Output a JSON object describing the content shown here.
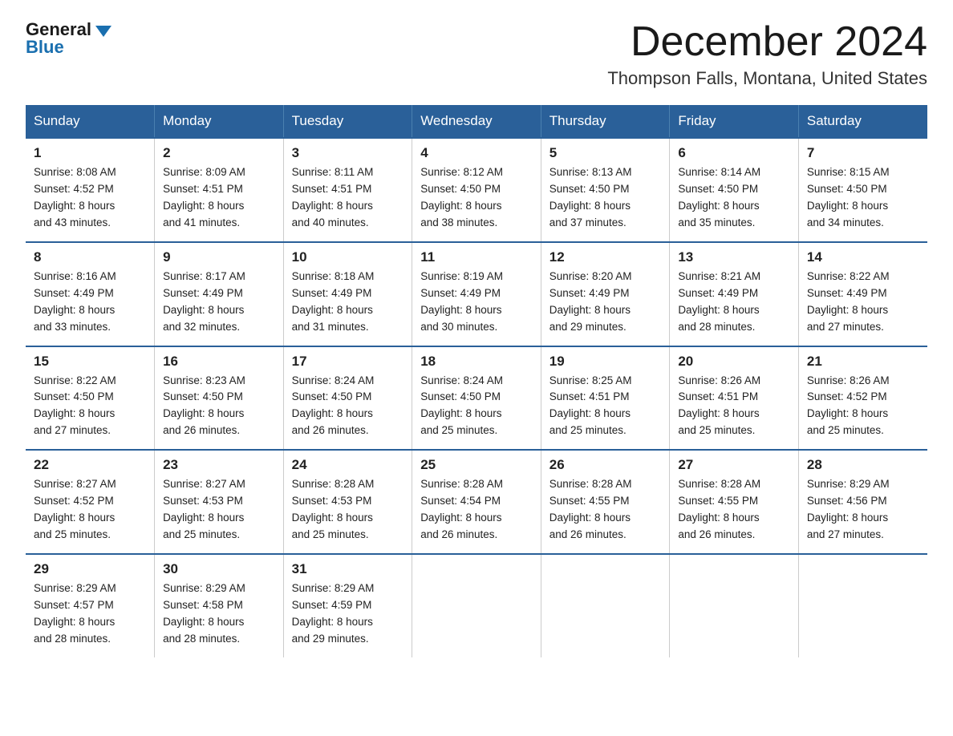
{
  "logo": {
    "general": "General",
    "blue": "Blue"
  },
  "header": {
    "month": "December 2024",
    "location": "Thompson Falls, Montana, United States"
  },
  "weekdays": [
    "Sunday",
    "Monday",
    "Tuesday",
    "Wednesday",
    "Thursday",
    "Friday",
    "Saturday"
  ],
  "weeks": [
    [
      {
        "day": "1",
        "sunrise": "8:08 AM",
        "sunset": "4:52 PM",
        "daylight": "8 hours and 43 minutes."
      },
      {
        "day": "2",
        "sunrise": "8:09 AM",
        "sunset": "4:51 PM",
        "daylight": "8 hours and 41 minutes."
      },
      {
        "day": "3",
        "sunrise": "8:11 AM",
        "sunset": "4:51 PM",
        "daylight": "8 hours and 40 minutes."
      },
      {
        "day": "4",
        "sunrise": "8:12 AM",
        "sunset": "4:50 PM",
        "daylight": "8 hours and 38 minutes."
      },
      {
        "day": "5",
        "sunrise": "8:13 AM",
        "sunset": "4:50 PM",
        "daylight": "8 hours and 37 minutes."
      },
      {
        "day": "6",
        "sunrise": "8:14 AM",
        "sunset": "4:50 PM",
        "daylight": "8 hours and 35 minutes."
      },
      {
        "day": "7",
        "sunrise": "8:15 AM",
        "sunset": "4:50 PM",
        "daylight": "8 hours and 34 minutes."
      }
    ],
    [
      {
        "day": "8",
        "sunrise": "8:16 AM",
        "sunset": "4:49 PM",
        "daylight": "8 hours and 33 minutes."
      },
      {
        "day": "9",
        "sunrise": "8:17 AM",
        "sunset": "4:49 PM",
        "daylight": "8 hours and 32 minutes."
      },
      {
        "day": "10",
        "sunrise": "8:18 AM",
        "sunset": "4:49 PM",
        "daylight": "8 hours and 31 minutes."
      },
      {
        "day": "11",
        "sunrise": "8:19 AM",
        "sunset": "4:49 PM",
        "daylight": "8 hours and 30 minutes."
      },
      {
        "day": "12",
        "sunrise": "8:20 AM",
        "sunset": "4:49 PM",
        "daylight": "8 hours and 29 minutes."
      },
      {
        "day": "13",
        "sunrise": "8:21 AM",
        "sunset": "4:49 PM",
        "daylight": "8 hours and 28 minutes."
      },
      {
        "day": "14",
        "sunrise": "8:22 AM",
        "sunset": "4:49 PM",
        "daylight": "8 hours and 27 minutes."
      }
    ],
    [
      {
        "day": "15",
        "sunrise": "8:22 AM",
        "sunset": "4:50 PM",
        "daylight": "8 hours and 27 minutes."
      },
      {
        "day": "16",
        "sunrise": "8:23 AM",
        "sunset": "4:50 PM",
        "daylight": "8 hours and 26 minutes."
      },
      {
        "day": "17",
        "sunrise": "8:24 AM",
        "sunset": "4:50 PM",
        "daylight": "8 hours and 26 minutes."
      },
      {
        "day": "18",
        "sunrise": "8:24 AM",
        "sunset": "4:50 PM",
        "daylight": "8 hours and 25 minutes."
      },
      {
        "day": "19",
        "sunrise": "8:25 AM",
        "sunset": "4:51 PM",
        "daylight": "8 hours and 25 minutes."
      },
      {
        "day": "20",
        "sunrise": "8:26 AM",
        "sunset": "4:51 PM",
        "daylight": "8 hours and 25 minutes."
      },
      {
        "day": "21",
        "sunrise": "8:26 AM",
        "sunset": "4:52 PM",
        "daylight": "8 hours and 25 minutes."
      }
    ],
    [
      {
        "day": "22",
        "sunrise": "8:27 AM",
        "sunset": "4:52 PM",
        "daylight": "8 hours and 25 minutes."
      },
      {
        "day": "23",
        "sunrise": "8:27 AM",
        "sunset": "4:53 PM",
        "daylight": "8 hours and 25 minutes."
      },
      {
        "day": "24",
        "sunrise": "8:28 AM",
        "sunset": "4:53 PM",
        "daylight": "8 hours and 25 minutes."
      },
      {
        "day": "25",
        "sunrise": "8:28 AM",
        "sunset": "4:54 PM",
        "daylight": "8 hours and 26 minutes."
      },
      {
        "day": "26",
        "sunrise": "8:28 AM",
        "sunset": "4:55 PM",
        "daylight": "8 hours and 26 minutes."
      },
      {
        "day": "27",
        "sunrise": "8:28 AM",
        "sunset": "4:55 PM",
        "daylight": "8 hours and 26 minutes."
      },
      {
        "day": "28",
        "sunrise": "8:29 AM",
        "sunset": "4:56 PM",
        "daylight": "8 hours and 27 minutes."
      }
    ],
    [
      {
        "day": "29",
        "sunrise": "8:29 AM",
        "sunset": "4:57 PM",
        "daylight": "8 hours and 28 minutes."
      },
      {
        "day": "30",
        "sunrise": "8:29 AM",
        "sunset": "4:58 PM",
        "daylight": "8 hours and 28 minutes."
      },
      {
        "day": "31",
        "sunrise": "8:29 AM",
        "sunset": "4:59 PM",
        "daylight": "8 hours and 29 minutes."
      },
      null,
      null,
      null,
      null
    ]
  ],
  "labels": {
    "sunrise": "Sunrise:",
    "sunset": "Sunset:",
    "daylight": "Daylight:"
  }
}
